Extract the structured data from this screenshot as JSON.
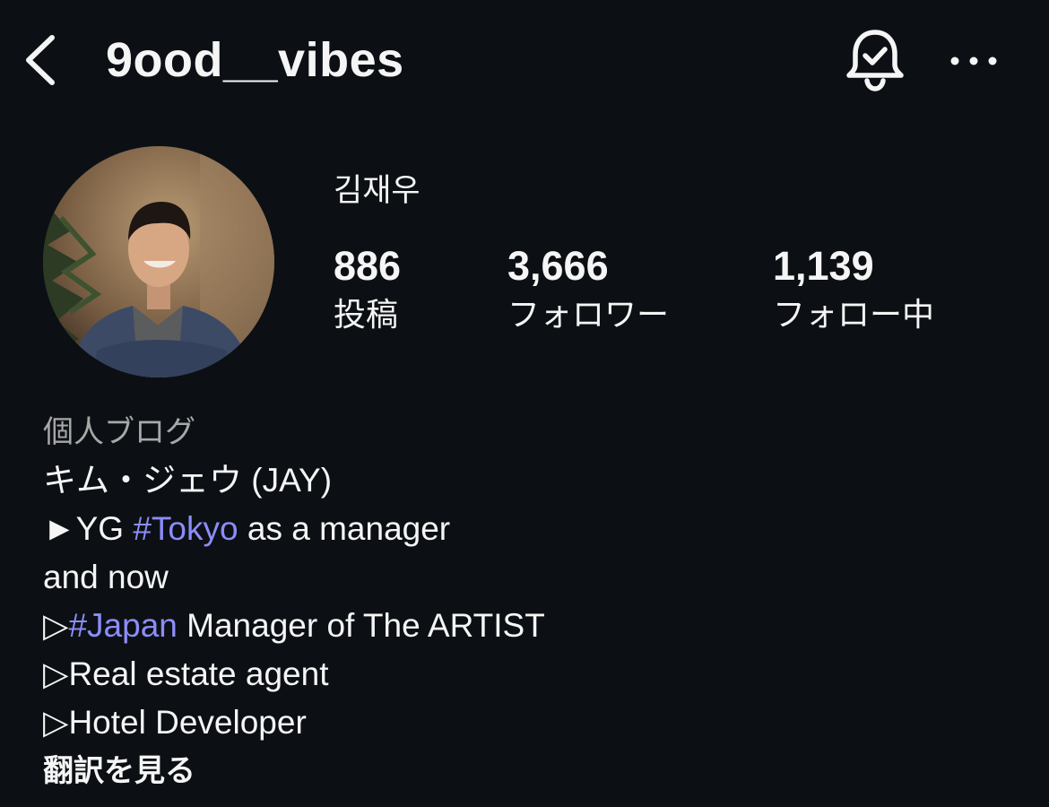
{
  "header": {
    "username": "9ood__vibes",
    "back_icon": "chevron-left-icon",
    "bell_icon": "bell-check-icon",
    "more_icon": "more-horizontal-icon"
  },
  "profile": {
    "display_name": "김재우",
    "avatar_icon": "profile-photo"
  },
  "stats": {
    "posts": {
      "value": "886",
      "label": "投稿"
    },
    "followers": {
      "value": "3,666",
      "label": "フォロワー"
    },
    "following": {
      "value": "1,139",
      "label": "フォロー中"
    }
  },
  "bio": {
    "category": "個人ブログ",
    "line1": "キム・ジェウ (JAY)",
    "line2_prefix": "►YG ",
    "line2_hashtag": "#Tokyo",
    "line2_suffix": " as a manager",
    "line3": "and now",
    "line4_prefix": "▷",
    "line4_hashtag": "#Japan",
    "line4_suffix": " Manager of The ARTIST",
    "line5": "▷Real estate agent",
    "line6": "▷Hotel Developer",
    "translate_label": "翻訳を見る"
  },
  "colors": {
    "background": "#0c1014",
    "text": "#f5f5f5",
    "muted": "#a8a8a8",
    "hashtag": "#8c8df8"
  }
}
